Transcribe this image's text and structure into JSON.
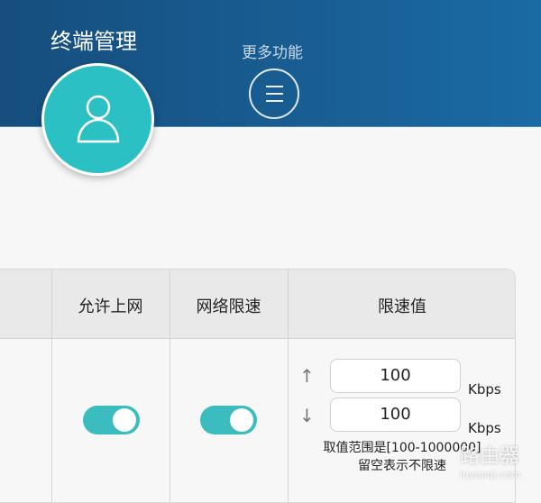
{
  "header": {
    "title": "终端管理",
    "more_label": "更多功能"
  },
  "table": {
    "columns": [
      "允许上网",
      "网络限速",
      "限速值"
    ],
    "row": {
      "allow_internet": true,
      "speed_limit": true,
      "upload": "100",
      "download": "100",
      "unit": "Kbps",
      "hint_line1": "取值范围是[100-1000000]",
      "hint_line2": "留空表示不限速"
    }
  },
  "watermark": {
    "cn": "路由器",
    "url": "luyouqi.com"
  }
}
